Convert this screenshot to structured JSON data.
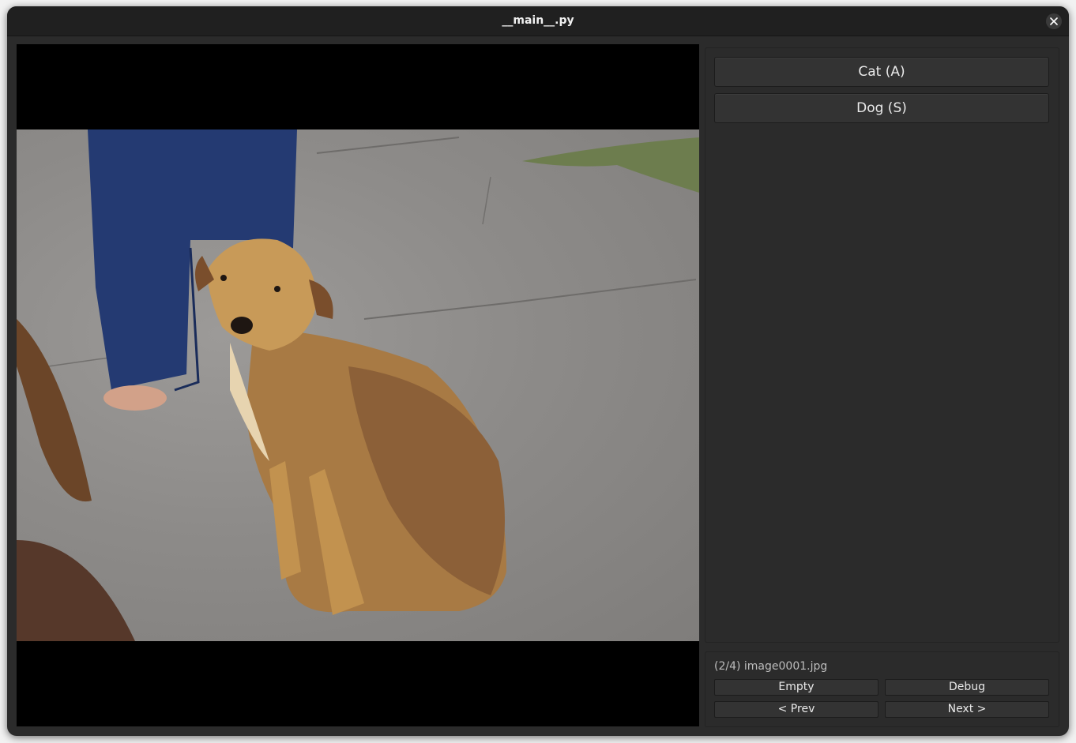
{
  "window": {
    "title": "__main__.py"
  },
  "viewer": {
    "image_description": "photo of a tan dog sitting on pavement"
  },
  "classes": [
    {
      "label": "Cat  (A)"
    },
    {
      "label": "Dog  (S)"
    }
  ],
  "footer": {
    "status": "(2/4) image0001.jpg",
    "buttons": {
      "empty": "Empty",
      "debug": "Debug",
      "prev": "< Prev",
      "next": "Next >"
    }
  },
  "colors": {
    "window_bg": "#2b2b2b",
    "titlebar_bg": "#202020",
    "button_bg": "#333333",
    "text": "#eaeaea"
  }
}
